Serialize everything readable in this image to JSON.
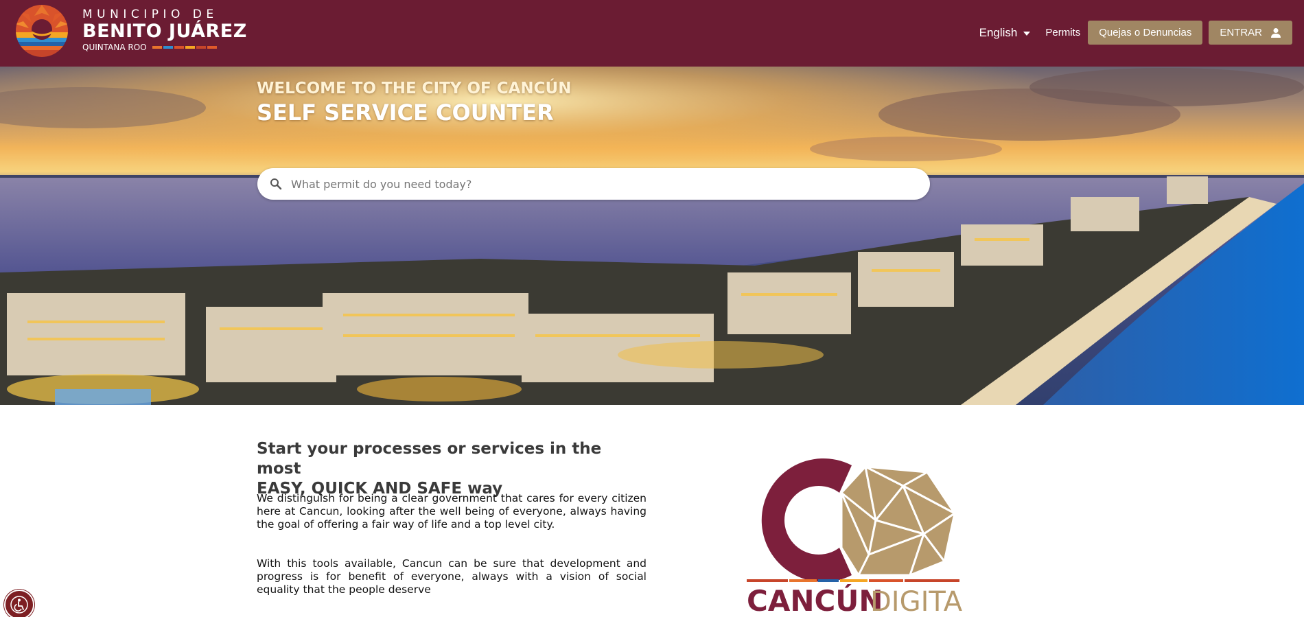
{
  "header": {
    "logo": {
      "line1": "MUNICIPIO DE",
      "line2": "BENITO JUÁREZ",
      "line3": "QUINTANA ROO"
    },
    "language": {
      "selected": "English",
      "icon": "caret-down-icon"
    },
    "permits_label": "Permits",
    "complaints_button": "Quejas o Denuncias",
    "login_button": "ENTRAR",
    "login_icon": "user-icon"
  },
  "hero": {
    "welcome": "WELCOME TO THE CITY OF CANCÚN",
    "subtitle": "SELF SERVICE COUNTER",
    "search": {
      "placeholder": "What permit do you need today?",
      "value": "",
      "icon": "search-icon"
    }
  },
  "main": {
    "title_line1": "Start your processes or services in the most",
    "title_line2": "EASY, QUICK AND SAFE way",
    "paragraph1": "We distinguish for being a clear government that cares for every citizen here at Cancun, looking after the well being of everyone, always having the goal of offering a fair way of life and a top level city.",
    "paragraph2": "With this tools available, Cancun can be sure that development and progress is for benefit of everyone, always with a vision of social equality that the people deserve",
    "logo_text_bold": "CANCÚN",
    "logo_text_light": "DIGITAL"
  },
  "accessibility_icon": "accessibility-icon",
  "colors": {
    "header_bg": "#6b1c33",
    "button_bg": "#a08663",
    "logo_maroon": "#7d1f3c",
    "logo_gold": "#b79a6c",
    "accessibility_bg": "#7d1f23"
  }
}
